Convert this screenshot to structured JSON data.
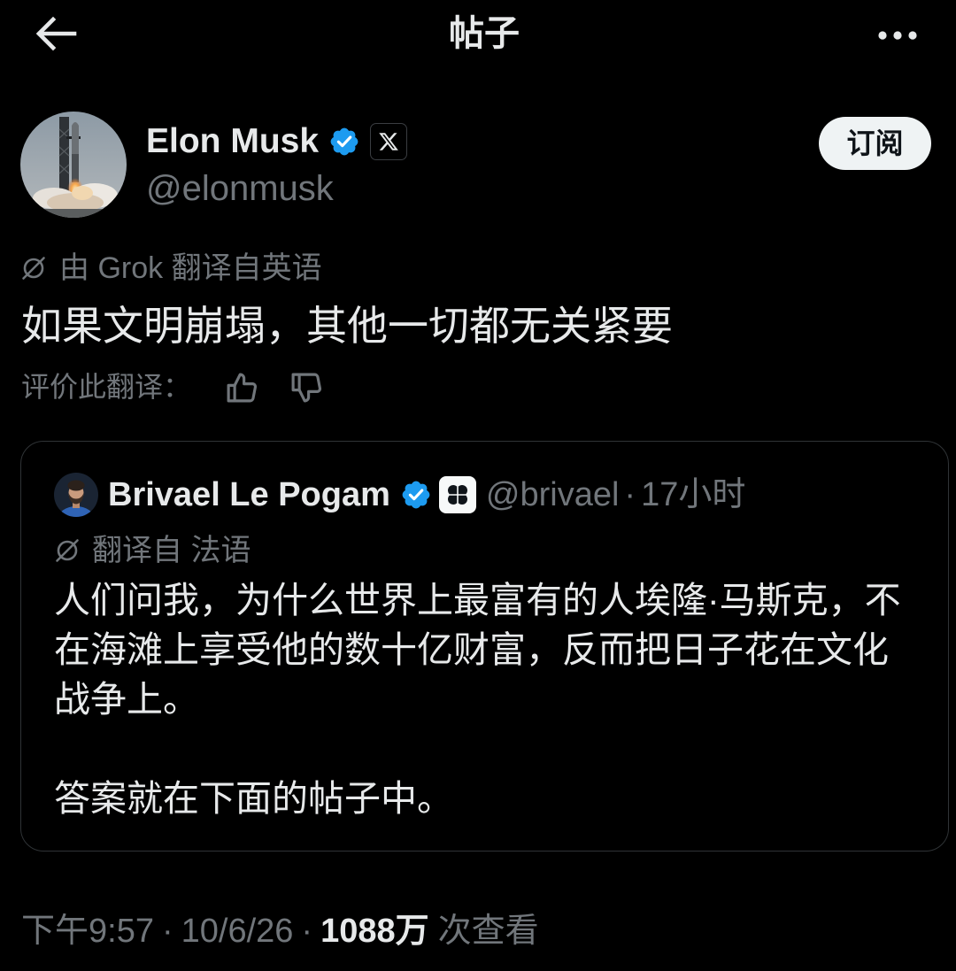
{
  "header": {
    "title": "帖子",
    "back_icon": "arrow-left-icon",
    "more_icon": "more-horizontal-icon"
  },
  "post": {
    "author": {
      "name": "Elon Musk",
      "handle": "@elonmusk",
      "verified_icon": "verified-badge-icon",
      "affiliation_icon": "x-logo-icon"
    },
    "subscribe_label": "订阅",
    "translation": {
      "icon": "translate-icon",
      "note": "由 Grok 翻译自英语"
    },
    "text": "如果文明崩塌，其他一切都无关紧要",
    "rating": {
      "label": "评价此翻译：",
      "like_icon": "thumbs-up-icon",
      "dislike_icon": "thumbs-down-icon"
    },
    "quote": {
      "author": {
        "name": "Brivael Le Pogam",
        "handle": "@brivael",
        "verified_icon": "verified-badge-icon",
        "affiliation_icon": "clover-icon"
      },
      "separator": "·",
      "time": "17小时",
      "translation": {
        "icon": "translate-icon",
        "note": "翻译自 法语"
      },
      "paragraphs": [
        "人们问我，为什么世界上最富有的人埃隆·马斯克，不在海滩上享受他的数十亿财富，反而把日子花在文化战争上。",
        "答案就在下面的帖子中。"
      ]
    },
    "meta": {
      "time": "下午9:57",
      "separator": "·",
      "date": "10/6/26",
      "views_count": "1088万",
      "views_label": "次查看"
    }
  },
  "colors": {
    "background": "#000000",
    "text": "#e7e9ea",
    "muted": "#71767b",
    "verified": "#1d9bf0",
    "border": "#2f3336",
    "button_background": "#eff3f4",
    "button_text": "#0f1419"
  }
}
